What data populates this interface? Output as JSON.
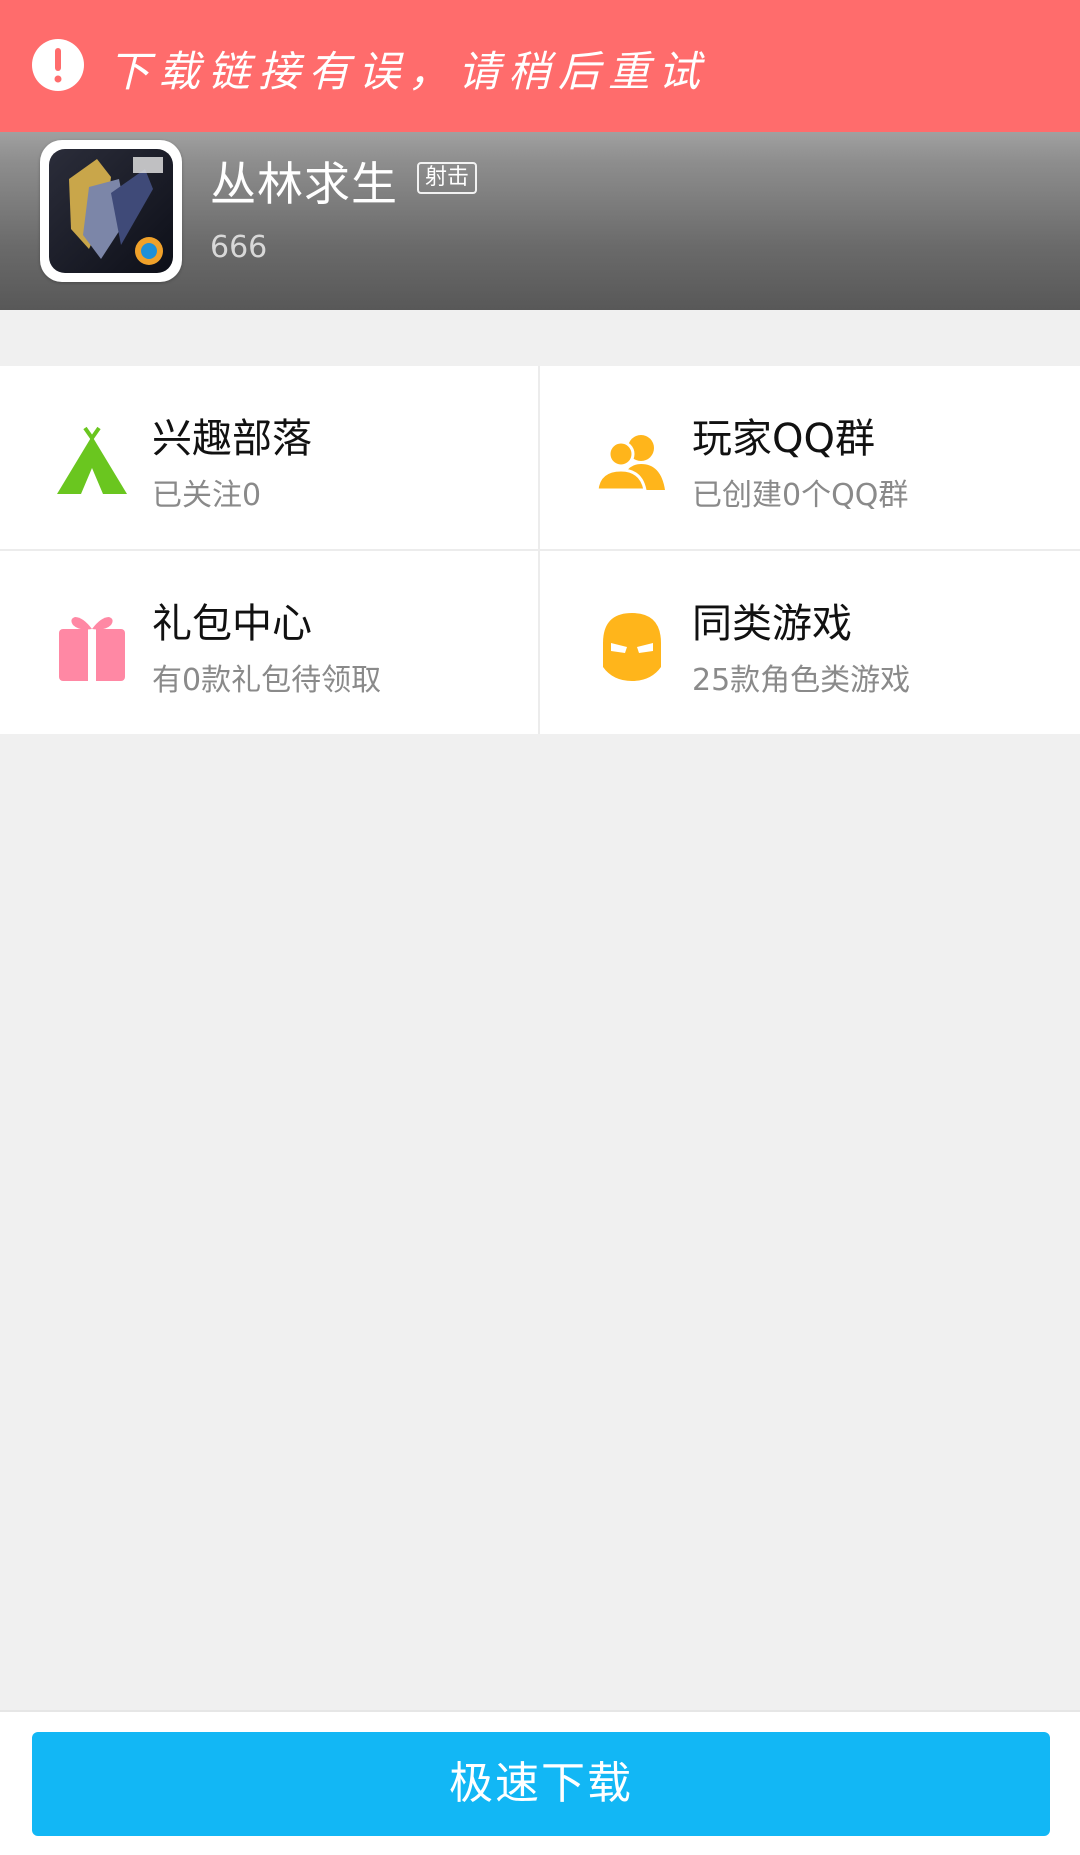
{
  "error_banner": {
    "message": "下载链接有误，请稍后重试",
    "icon": "alert-icon"
  },
  "game": {
    "title": "丛林求生",
    "genre_tag": "射击",
    "subtitle": "666",
    "icon": "game-app-icon"
  },
  "features": [
    {
      "title": "兴趣部落",
      "desc": "已关注0",
      "icon": "tent-icon",
      "color": "#6ac61f"
    },
    {
      "title": "玩家QQ群",
      "desc": "已创建0个QQ群",
      "icon": "group-icon",
      "color": "#ffb51b"
    },
    {
      "title": "礼包中心",
      "desc": "有0款礼包待领取",
      "icon": "gift-icon",
      "color": "#ff88a4"
    },
    {
      "title": "同类游戏",
      "desc": "25款角色类游戏",
      "icon": "mask-icon",
      "color": "#ffb51b"
    }
  ],
  "bottom": {
    "download_label": "极速下载"
  },
  "colors": {
    "banner": "#ff6c6c",
    "button": "#12b7f5"
  }
}
